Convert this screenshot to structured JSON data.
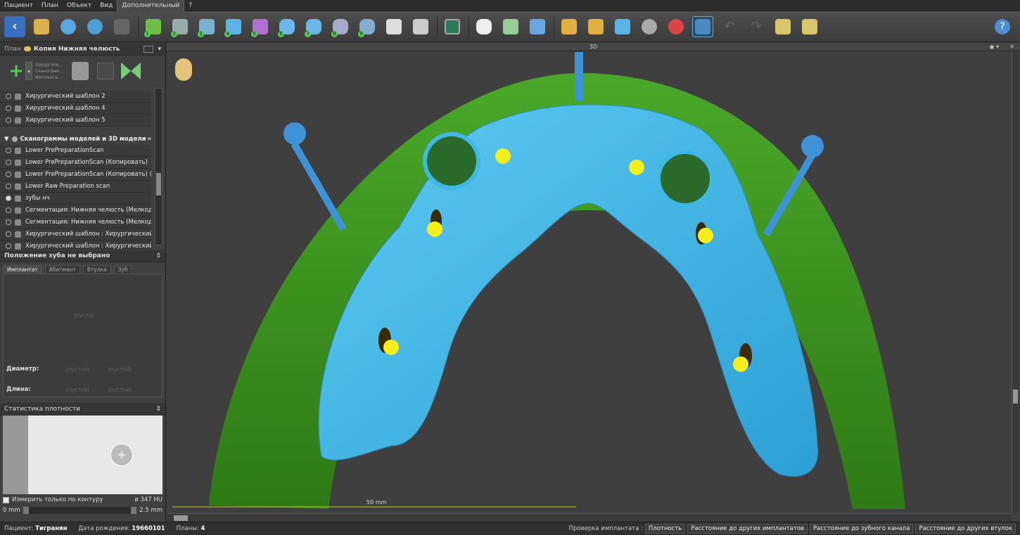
{
  "menu": [
    "Пациент",
    "План",
    "Объект",
    "Вид",
    "Дополнительный",
    "?"
  ],
  "plan": {
    "label": "План",
    "name": "Копия Нижняя челюсть"
  },
  "add_group": {
    "lines": [
      "Хирургиче...",
      "Сканограм...",
      "Импланта..."
    ]
  },
  "surgical_items": [
    "Хирургический шаблон 2",
    "Хирургический шаблон 4",
    "Хирургический шаблон 5"
  ],
  "scans_section": {
    "title": "Сканограммы моделей и 3D модели",
    "items": [
      {
        "label": "Lower PrePreparationScan",
        "selected": false
      },
      {
        "label": "Lower PrePreparationScan (Копировать)",
        "selected": false
      },
      {
        "label": "Lower PrePreparationScan (Копировать) (K...",
        "selected": false
      },
      {
        "label": "Lower Raw Preparation scan",
        "selected": false
      },
      {
        "label": "зубы нч",
        "selected": true
      },
      {
        "label": "Сегментация: Нижняя челюсть (Мелкоди...",
        "selected": false
      },
      {
        "label": "Сегментация: Нижняя челюсть (Мелкоди...",
        "selected": false
      },
      {
        "label": "Хирургический шаблон : Хирургический ...",
        "selected": false
      },
      {
        "label": "Хирургический шаблон : Хирургический ...",
        "selected": false
      }
    ]
  },
  "tooth_position": {
    "title": "Положение зуба не выбрано",
    "tabs": [
      "Имплантат",
      "Абатмент",
      "Втулка",
      "Зуб"
    ],
    "empty": "(пусто)",
    "diameter_label": "Диаметр:",
    "length_label": "Длина:",
    "empty_value": "(пустой)"
  },
  "density": {
    "title": "Статистика плотности",
    "measure_label": "Измерить только по контуру",
    "hu": "ø 347 HU",
    "range_min": "0 mm",
    "range_max": "2.5 mm"
  },
  "viewport": {
    "title": "3D",
    "scale_label": "50 mm"
  },
  "status": {
    "patient_label": "Пациент:",
    "patient": "Тигранян",
    "dob_label": "Дата рождения:",
    "dob": "19660101",
    "plans_label": "Планы:",
    "plans": "4",
    "check_label": "Проверка имплантата :",
    "buttons": [
      "Плотность",
      "Расстояние до других имплантатов",
      "Расстояние до зубного канала",
      "Расстояние до других втулок"
    ]
  },
  "colors": {
    "scan": "#3fb8e6",
    "bone": "#3a9a1e",
    "marker": "#f5ee1a",
    "accent": "#2a7ac8"
  }
}
